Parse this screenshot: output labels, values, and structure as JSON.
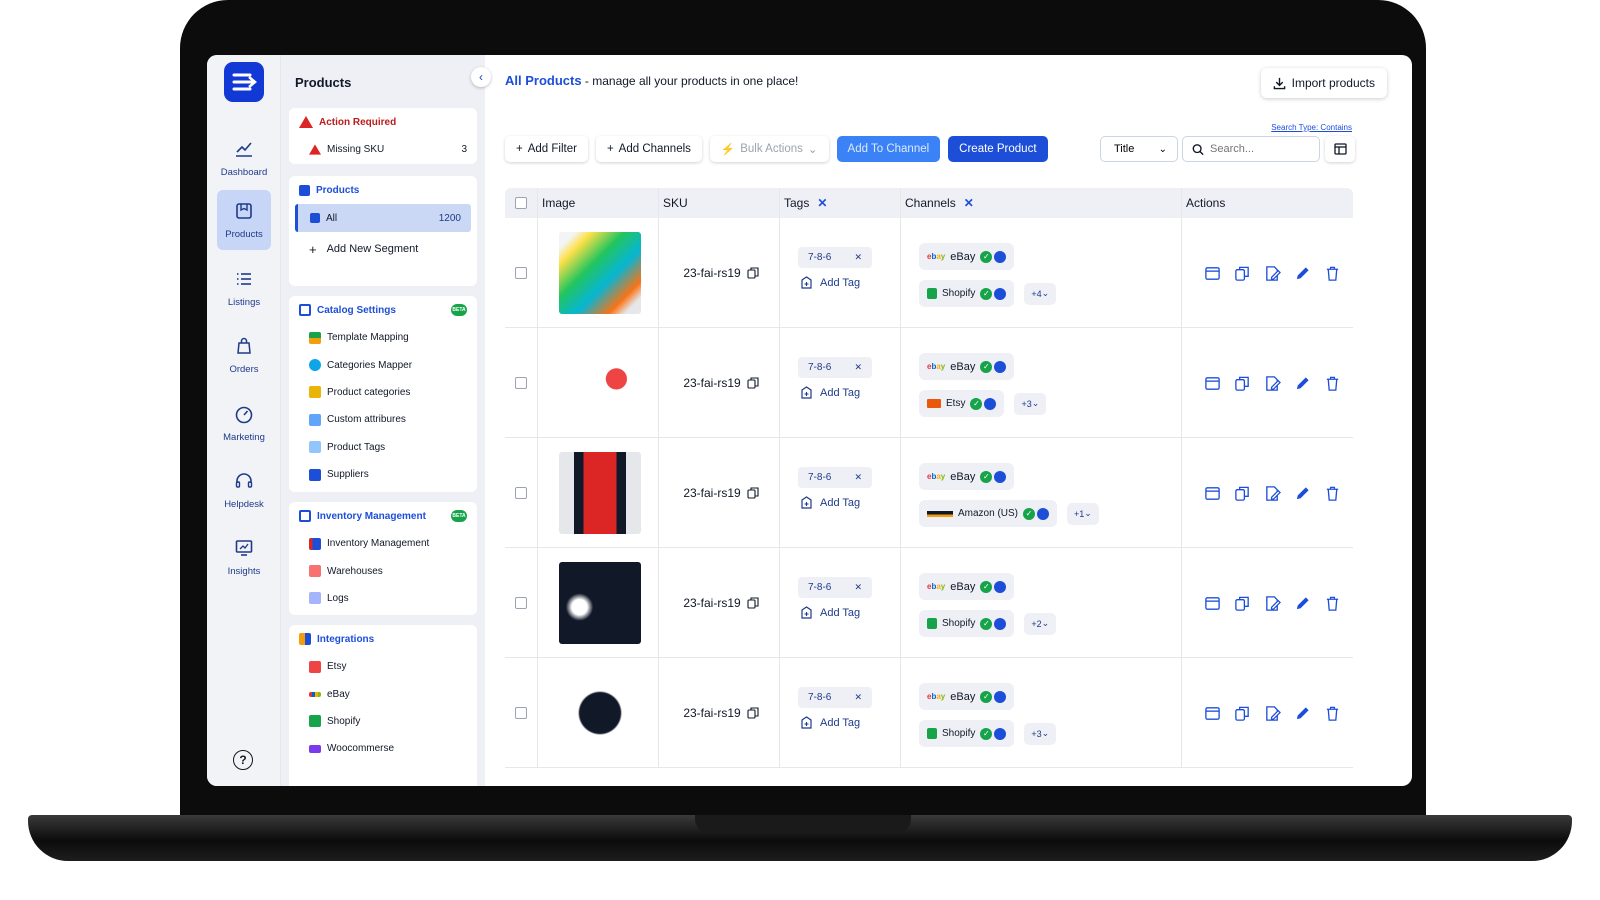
{
  "rail": {
    "items": [
      {
        "label": "Dashboard",
        "icon": "chart-line-icon"
      },
      {
        "label": "Products",
        "icon": "box-icon"
      },
      {
        "label": "Listings",
        "icon": "list-icon"
      },
      {
        "label": "Orders",
        "icon": "bag-icon"
      },
      {
        "label": "Marketing",
        "icon": "gauge-icon"
      },
      {
        "label": "Helpdesk",
        "icon": "headset-icon"
      },
      {
        "label": "Insights",
        "icon": "monitor-icon"
      }
    ],
    "help": "?"
  },
  "sidebar": {
    "title": "Products",
    "action_required": {
      "title": "Action Required",
      "missing_sku": "Missing SKU",
      "missing_count": "3"
    },
    "products": {
      "title": "Products",
      "all": "All",
      "all_count": "1200",
      "add_segment": "Add New Segment"
    },
    "catalog": {
      "title": "Catalog Settings",
      "badge": "BETA",
      "items": [
        "Template Mapping",
        "Categories Mapper",
        "Product categories",
        "Custom attribures",
        "Product Tags",
        "Suppliers"
      ]
    },
    "inventory": {
      "title": "Inventory Management",
      "badge": "BETA",
      "items": [
        "Inventory Management",
        "Warehouses",
        "Logs"
      ]
    },
    "integrations": {
      "title": "Integrations",
      "items": [
        "Etsy",
        "eBay",
        "Shopify",
        "Woocommerse"
      ]
    }
  },
  "main": {
    "title": "All Products",
    "subtitle": " - manage all your products in one place!",
    "import": "Import products",
    "toolbar": {
      "add_filter": "Add Filter",
      "add_channels": "Add Channels",
      "bulk_actions": "Bulk Actions",
      "add_to_channel": "Add To Channel",
      "create_product": "Create Product"
    },
    "search_type": "Search Type: Contains",
    "title_select": "Title",
    "search_placeholder": "Search..."
  },
  "table": {
    "headers": {
      "image": "Image",
      "sku": "SKU",
      "tags": "Tags",
      "channels": "Channels",
      "actions": "Actions"
    },
    "add_tag": "Add Tag",
    "rows": [
      {
        "sku": "23-fai-rs19",
        "tag": "7-8-6",
        "ch1": "eBay",
        "ch2": "Shopify",
        "more": "+4"
      },
      {
        "sku": "23-fai-rs19",
        "tag": "7-8-6",
        "ch1": "eBay",
        "ch2": "Etsy",
        "more": "+3"
      },
      {
        "sku": "23-fai-rs19",
        "tag": "7-8-6",
        "ch1": "eBay",
        "ch2": "Amazon (US)",
        "more": "+1"
      },
      {
        "sku": "23-fai-rs19",
        "tag": "7-8-6",
        "ch1": "eBay",
        "ch2": "Shopify",
        "more": "+2"
      },
      {
        "sku": "23-fai-rs19",
        "tag": "7-8-6",
        "ch1": "eBay",
        "ch2": "Shopify",
        "more": "+3"
      }
    ]
  },
  "colors": {
    "primary": "#1d4ed8",
    "brand": "#1238d6",
    "success": "#16a34a"
  }
}
